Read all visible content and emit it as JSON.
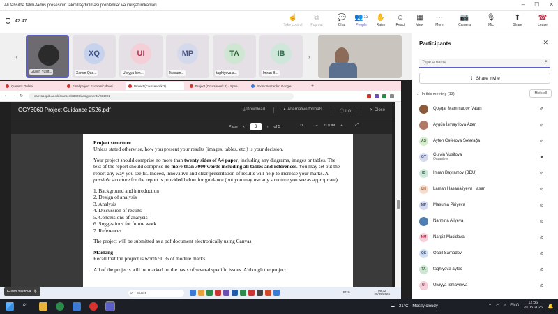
{
  "window": {
    "title": "Ali təhsildə təlim-tədris prosesinin təkmilləşdirilməsi problemlər və inkişaf imkanları",
    "timer": "42:47"
  },
  "toolbar": {
    "take_control": "Take control",
    "pop_out": "Pop out",
    "chat": "Chat",
    "people": "People",
    "people_count": "13",
    "raise": "Raise",
    "react": "React",
    "view": "View",
    "more": "More",
    "camera": "Camera",
    "mic": "Mic",
    "share": "Share",
    "leave": "Leave"
  },
  "gallery": [
    {
      "initials": "",
      "name": "Gulvin Yusif...",
      "bg": "#6d6a70",
      "fg": "#ffffff"
    },
    {
      "initials": "XQ",
      "name": "Xanım Qad...",
      "bg": "#c7d2ec",
      "fg": "#3a4f8a"
    },
    {
      "initials": "UI",
      "name": "Ulviyya Ism...",
      "bg": "#f4cfd8",
      "fg": "#b03050"
    },
    {
      "initials": "MP",
      "name": "Masum...",
      "bg": "#d5d9ec",
      "fg": "#4a5580"
    },
    {
      "initials": "TA",
      "name": "taghiyeva a...",
      "bg": "#cfe6d3",
      "fg": "#2f6b3a"
    },
    {
      "initials": "IB",
      "name": "Imran B...",
      "bg": "#cfe7da",
      "fg": "#2f6b4a"
    }
  ],
  "browser": {
    "tabs": [
      "Queen's Online",
      "Final project Economic devel...",
      "Project (Coursework 2)",
      "Project (Coursework 2) - Spee...",
      "Boom: Məzənləri Google..."
    ],
    "url": "canvas.qub.ac.uk/courses/33820/assignments/234391"
  },
  "pdf": {
    "title": "GGY3060 Project Guidance 2526.pdf",
    "download": "Download",
    "alt_formats": "Alternative formats",
    "info": "Info",
    "close": "Close",
    "page_label": "Page",
    "page_num": "3",
    "page_total": "of 5",
    "zoom_label": "ZOOM",
    "heading_structure": "Project structure",
    "p1": "Unless stated otherwise, how you present your results (images, tables, etc.) is your decision.",
    "p2a": "Your project should comprise no more than ",
    "p2b": "twenty sides of A4 paper",
    "p2c": ", including any diagrams, images or tables. The text of the report should comprise ",
    "p2d": "no more than 3000 words including all tables and references",
    "p2e": ". You may set out the report any way you see fit. Indeed, innovative and clear presentation of results will help to increase your marks. A ",
    "p2f": "possible",
    "p2g": " structure for the report is provided below for guidance (but you may use any structure you see as appropriate).",
    "list": [
      "1. Background and introduction",
      "2. Design of analysis",
      "3. Analysis",
      "4. Discussion of results",
      "5. Conclusions of analysis",
      "6. Suggestions for future work",
      "7. References"
    ],
    "p3": "The project will be submitted as a pdf document electronically using Canvas.",
    "heading_marking": "Marking",
    "p4": "Recall that the project is worth 50 % of module marks.",
    "p5": "All of the projects will be marked on the basis of several specific issues. Although the project"
  },
  "inner_taskbar": {
    "search": "Search",
    "lang": "ENG",
    "time": "09:32",
    "date": "20/05/2026"
  },
  "presenter": "Gulvin Yusifova",
  "panel": {
    "title": "Participants",
    "search_placeholder": "Type a name",
    "share_invite": "Share invite",
    "section": "In this meeting (13)",
    "mute_all": "Mute all",
    "participants": [
      {
        "initials": "",
        "name": "Qoşqar Mammadov Vatan",
        "role": "",
        "bg": "#8a5a3a",
        "fg": "#ffffff",
        "hand": false
      },
      {
        "initials": "",
        "name": "Aygün İsmayılova Azər",
        "role": "",
        "bg": "#b07a62",
        "fg": "#ffffff",
        "hand": false
      },
      {
        "initials": "AS",
        "name": "Aytən Cəfərova Səfərağa",
        "role": "",
        "bg": "#d9ead3",
        "fg": "#3f6b33",
        "hand": false
      },
      {
        "initials": "GY",
        "name": "Gulvin Yusifova",
        "role": "Organizer",
        "bg": "#d5d9ec",
        "fg": "#4a5580",
        "hand": true
      },
      {
        "initials": "IB",
        "name": "Imran Bayramov (BDU)",
        "role": "",
        "bg": "#cfe7da",
        "fg": "#2f6b4a",
        "hand": true
      },
      {
        "initials": "LH",
        "name": "Laman Hasanaliyeva Hasan",
        "role": "",
        "bg": "#f6dccb",
        "fg": "#a0522d",
        "hand": false
      },
      {
        "initials": "MP",
        "name": "Masuma Piriyeva",
        "role": "",
        "bg": "#d5d9ec",
        "fg": "#4a5580",
        "hand": true
      },
      {
        "initials": "",
        "name": "Narmina Aliyeva",
        "role": "",
        "bg": "#4f7fb0",
        "fg": "#ffffff",
        "hand": false
      },
      {
        "initials": "NM",
        "name": "Nargiz Macidova",
        "role": "",
        "bg": "#f4cfd8",
        "fg": "#b03050",
        "hand": true
      },
      {
        "initials": "QS",
        "name": "Qabil Samadov",
        "role": "",
        "bg": "#d3dff0",
        "fg": "#34527a",
        "hand": true
      },
      {
        "initials": "TA",
        "name": "taghiyeva aytac",
        "role": "",
        "bg": "#cfe6d3",
        "fg": "#2f6b3a",
        "hand": true
      },
      {
        "initials": "UI",
        "name": "Ulviyya Ismayilova",
        "role": "",
        "bg": "#f4cfd8",
        "fg": "#b03050",
        "hand": false
      }
    ]
  },
  "taskbar": {
    "temp": "21°C",
    "weather": "Mostly cloudy",
    "lang": "ENG",
    "time": "12:36",
    "date": "20.05.2026"
  },
  "colors": {
    "accent": "#5b5fc7",
    "leave": "#c4314b",
    "pdf_bar": "#262626"
  }
}
